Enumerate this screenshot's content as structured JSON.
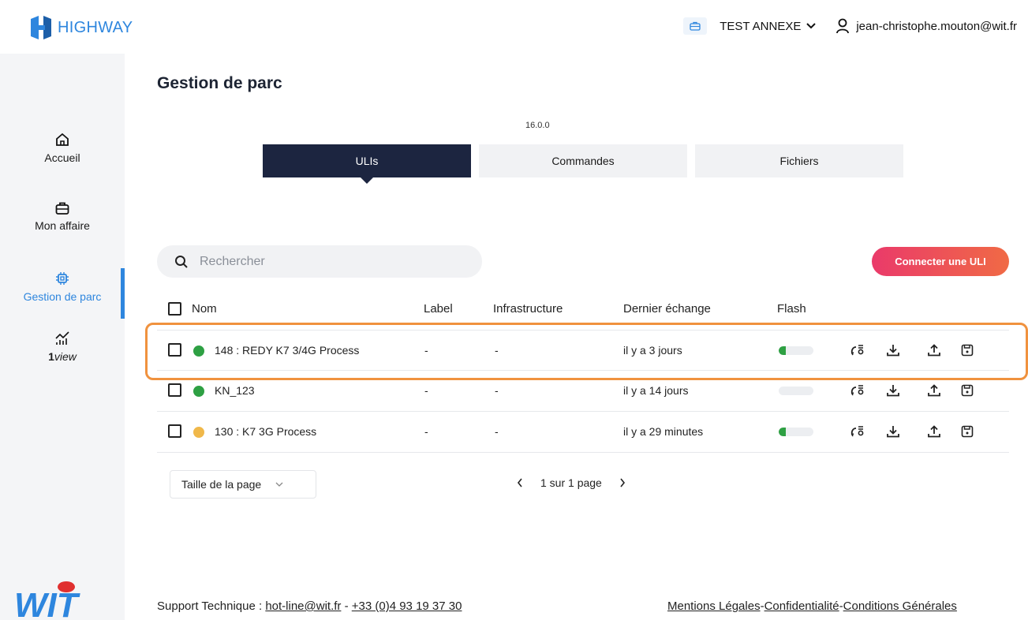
{
  "brand": {
    "name": "HIGHWAY",
    "color": "#2e86de"
  },
  "topbar": {
    "client": "TEST ANNEXE",
    "user": "jean-christophe.mouton@wit.fr"
  },
  "sidebar": {
    "items": [
      {
        "label": "Accueil",
        "icon": "home-icon"
      },
      {
        "label": "Mon affaire",
        "icon": "briefcase-icon"
      },
      {
        "label": "Gestion de parc",
        "icon": "chip-icon"
      },
      {
        "label_bold": "1",
        "label_italic": "view",
        "icon": "chart-icon"
      }
    ],
    "active": "Gestion de parc",
    "footer_logo": "WIT"
  },
  "main": {
    "title": "Gestion de parc",
    "version": "16.0.0",
    "tabs": [
      "ULIs",
      "Commandes",
      "Fichiers"
    ],
    "active_tab": "ULIs",
    "search_placeholder": "Rechercher",
    "connect_button": "Connecter une ULI"
  },
  "table": {
    "columns": [
      "Nom",
      "Label",
      "Infrastructure",
      "Dernier échange",
      "Flash"
    ],
    "rows": [
      {
        "name": "148 : REDY K7 3/4G Process",
        "label": "-",
        "infra": "-",
        "last": "il y a 3 jours",
        "status_color": "#2ea043",
        "flash_fraction": 0.2
      },
      {
        "name": "KN_123",
        "label": "-",
        "infra": "-",
        "last": "il y a 14 jours",
        "status_color": "#2ea043",
        "flash_fraction": 0
      },
      {
        "name": "130 : K7 3G Process",
        "label": "-",
        "infra": "-",
        "last": "il y a 29 minutes",
        "status_color": "#f0b84a",
        "flash_fraction": 0.2
      }
    ],
    "row_actions": [
      "config-sync-icon",
      "download-icon",
      "upload-icon",
      "save-icon"
    ]
  },
  "pagination": {
    "page_size_label": "Taille de la page",
    "page_text": "1 sur 1 page"
  },
  "footer": {
    "support_label": "Support Technique :",
    "email": "hot-line@wit.fr",
    "separator": "-",
    "phone": "+33 (0)4 93 19 37 30",
    "links": [
      "Mentions Légales",
      "Confidentialité",
      "Conditions Générales"
    ]
  }
}
